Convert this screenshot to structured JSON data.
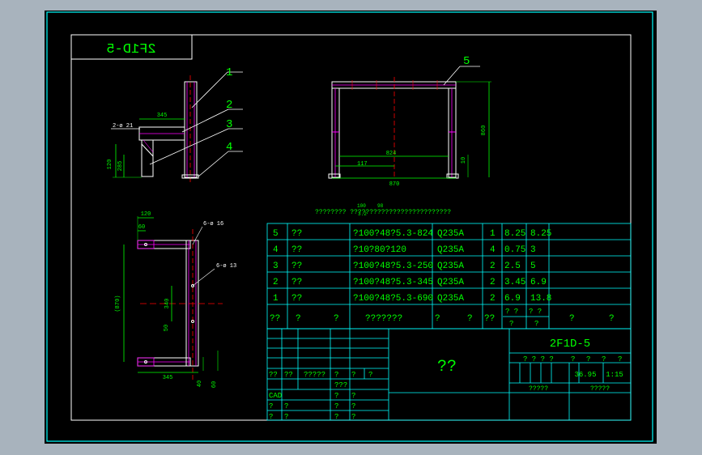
{
  "title_block_mirrored": "2F1D-5",
  "views": {
    "side": {
      "leaders": [
        "1",
        "2",
        "3",
        "4"
      ],
      "dim_width": "345",
      "label_bolt": "2-ø 21",
      "dim_height_a": "120",
      "dim_height_b": "285"
    },
    "front": {
      "leader": "5",
      "dim_height": "860",
      "dim_inner": "824",
      "dim_left": "117",
      "dim_total": "870",
      "dim_foot": "10"
    },
    "plan": {
      "dim_top": "120",
      "dim_top2": "60",
      "label_hole1": "6-ø 16",
      "label_hole2": "6-ø 13",
      "dim_span": "(870)",
      "dim_mid": "340",
      "dim_small": "50",
      "dim_bottom": "345",
      "dim_r1": "40",
      "dim_r2": "60"
    }
  },
  "tech_note": "???????? ??????????????????????????",
  "roughness": {
    "a": "100",
    "b": "3.2",
    "c": "98"
  },
  "bom": {
    "rows": [
      {
        "no": "5",
        "name": "??",
        "spec": "?100?48?5.3-824",
        "mat": "Q235A",
        "qty": "1",
        "w1": "8.25",
        "w2": "8.25"
      },
      {
        "no": "4",
        "name": "??",
        "spec": "?10?80?120",
        "mat": "Q235A",
        "qty": "4",
        "w1": "0.75",
        "w2": "3"
      },
      {
        "no": "3",
        "name": "??",
        "spec": "?100?48?5.3-250",
        "mat": "Q235A",
        "qty": "2",
        "w1": "2.5",
        "w2": "5"
      },
      {
        "no": "2",
        "name": "??",
        "spec": "?100?48?5.3-345",
        "mat": "Q235A",
        "qty": "2",
        "w1": "3.45",
        "w2": "6.9"
      },
      {
        "no": "1",
        "name": "??",
        "spec": "?100?48?5.3-690",
        "mat": "Q235A",
        "qty": "2",
        "w1": "6.9",
        "w2": "13.8"
      }
    ],
    "header": {
      "no": "??",
      "name1": "?",
      "name2": "?",
      "spec": "???????",
      "mat1": "?",
      "mat2": "?",
      "qty": "??",
      "w1a": "? ?",
      "w1b": "?",
      "w2a": "? ?",
      "w2b": "?",
      "rem1": "?",
      "rem2": "?"
    }
  },
  "titleblock": {
    "drawing_no": "2F1D-5",
    "name": "??",
    "hdr": [
      "? ? ? ?",
      "?",
      "?",
      "?",
      "?"
    ],
    "weight": "36.95",
    "scale": "1:15",
    "foot1": "?????",
    "foot2": "?????",
    "left_rows": [
      [
        "??",
        "??",
        "?????",
        "?",
        "?",
        "?"
      ],
      [
        "",
        "",
        "",
        "???",
        "",
        ""
      ],
      [
        "CAD",
        "",
        "",
        "?",
        "?",
        ""
      ],
      [
        "?",
        "?",
        "",
        "?",
        "?",
        ""
      ],
      [
        "?",
        "?",
        "",
        "?",
        "?",
        ""
      ]
    ]
  },
  "colors": {
    "frame": "#00ffff",
    "line": "#ffffff",
    "dim": "#00ff00",
    "part": "#ff00ff",
    "center": "#ff0000",
    "text": "#00ff00"
  }
}
